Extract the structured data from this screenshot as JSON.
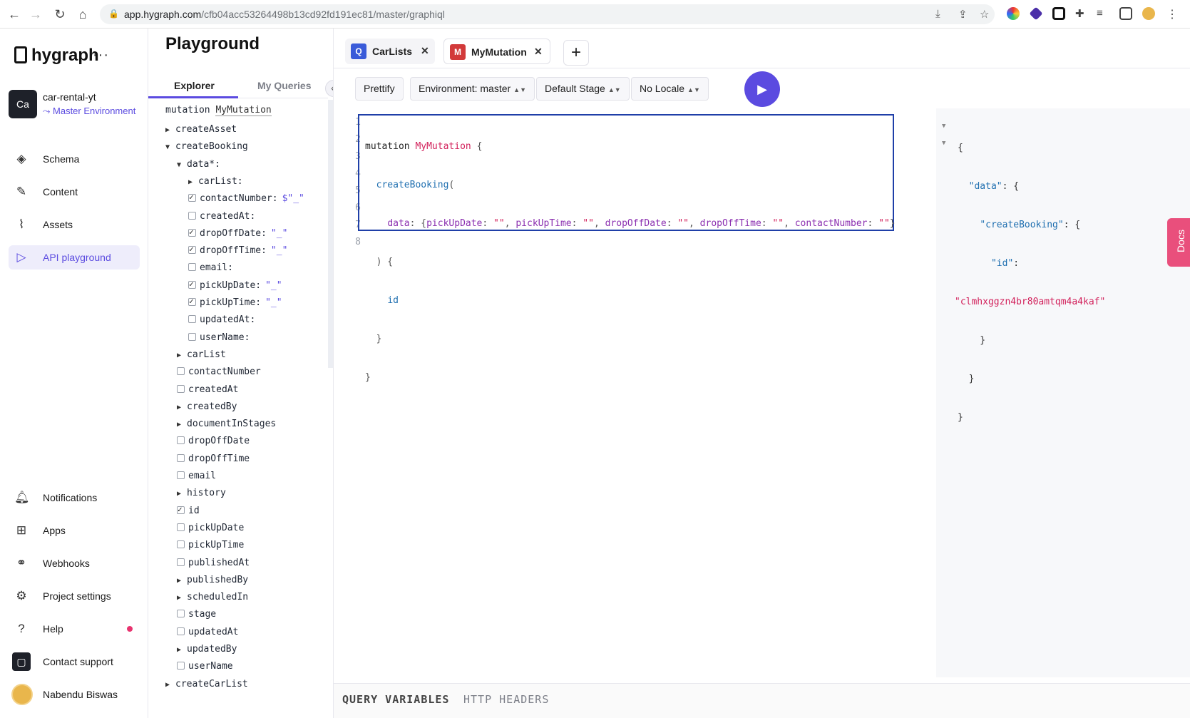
{
  "browser": {
    "url_host": "app.hygraph.com",
    "url_path": "/cfb04acc53264498b13cd92fd191ec81/master/graphiql"
  },
  "brand": {
    "name": "hygraph",
    "menu": "···"
  },
  "project": {
    "badge": "Ca",
    "name": "car-rental-yt",
    "environment": "Master Environment"
  },
  "nav": {
    "schema": "Schema",
    "content": "Content",
    "assets": "Assets",
    "api_playground": "API playground",
    "notifications": "Notifications",
    "apps": "Apps",
    "webhooks": "Webhooks",
    "project_settings": "Project settings",
    "help": "Help",
    "contact_support": "Contact support",
    "user": "Nabendu Biswas"
  },
  "explorer": {
    "title": "Playground",
    "tab_explorer": "Explorer",
    "tab_queries": "My Queries",
    "op_keyword": "mutation",
    "op_name": "MyMutation",
    "rows": [
      {
        "label": "createAsset",
        "kind": "arrow-right",
        "indent": 1
      },
      {
        "label": "createBooking",
        "kind": "arrow-down",
        "indent": 1
      },
      {
        "label": "data*:",
        "kind": "arrow-down",
        "indent": 2
      },
      {
        "label": "carList:",
        "kind": "arrow-right",
        "indent": 3
      },
      {
        "label": "contactNumber:",
        "kind": "checked",
        "indent": 3,
        "value": "$\"_\""
      },
      {
        "label": "createdAt:",
        "kind": "unchecked",
        "indent": 3
      },
      {
        "label": "dropOffDate:",
        "kind": "checked",
        "indent": 3,
        "value": "\"_\""
      },
      {
        "label": "dropOffTime:",
        "kind": "checked",
        "indent": 3,
        "value": "\"_\""
      },
      {
        "label": "email:",
        "kind": "unchecked",
        "indent": 3
      },
      {
        "label": "pickUpDate:",
        "kind": "checked",
        "indent": 3,
        "value": "\"_\""
      },
      {
        "label": "pickUpTime:",
        "kind": "checked",
        "indent": 3,
        "value": "\"_\""
      },
      {
        "label": "updatedAt:",
        "kind": "unchecked",
        "indent": 3
      },
      {
        "label": "userName:",
        "kind": "unchecked",
        "indent": 3
      },
      {
        "label": "carList",
        "kind": "arrow-right",
        "indent": 2
      },
      {
        "label": "contactNumber",
        "kind": "unchecked",
        "indent": 2
      },
      {
        "label": "createdAt",
        "kind": "unchecked",
        "indent": 2
      },
      {
        "label": "createdBy",
        "kind": "arrow-right",
        "indent": 2
      },
      {
        "label": "documentInStages",
        "kind": "arrow-right",
        "indent": 2
      },
      {
        "label": "dropOffDate",
        "kind": "unchecked",
        "indent": 2
      },
      {
        "label": "dropOffTime",
        "kind": "unchecked",
        "indent": 2
      },
      {
        "label": "email",
        "kind": "unchecked",
        "indent": 2
      },
      {
        "label": "history",
        "kind": "arrow-right",
        "indent": 2
      },
      {
        "label": "id",
        "kind": "checked",
        "indent": 2
      },
      {
        "label": "pickUpDate",
        "kind": "unchecked",
        "indent": 2
      },
      {
        "label": "pickUpTime",
        "kind": "unchecked",
        "indent": 2
      },
      {
        "label": "publishedAt",
        "kind": "unchecked",
        "indent": 2
      },
      {
        "label": "publishedBy",
        "kind": "arrow-right",
        "indent": 2
      },
      {
        "label": "scheduledIn",
        "kind": "arrow-right",
        "indent": 2
      },
      {
        "label": "stage",
        "kind": "unchecked",
        "indent": 2
      },
      {
        "label": "updatedAt",
        "kind": "unchecked",
        "indent": 2
      },
      {
        "label": "updatedBy",
        "kind": "arrow-right",
        "indent": 2
      },
      {
        "label": "userName",
        "kind": "unchecked",
        "indent": 2
      },
      {
        "label": "createCarList",
        "kind": "arrow-right",
        "indent": 1
      }
    ]
  },
  "query_tabs": [
    {
      "badge": "Q",
      "label": "CarLists",
      "color": "#3a5bd9"
    },
    {
      "badge": "M",
      "label": "MyMutation",
      "color": "#d23a3a"
    }
  ],
  "toolbar": {
    "prettify": "Prettify",
    "environment": "Environment: master",
    "stage": "Default Stage",
    "locale": "No Locale"
  },
  "editor": {
    "line_numbers": [
      "1",
      "2",
      "3",
      "4",
      "5",
      "6",
      "7",
      "8"
    ]
  },
  "result": {
    "id_value": "\"clmhxggzn4br80amtqm4a4kaf\""
  },
  "docs_label": "Docs",
  "bottom": {
    "variables": "QUERY VARIABLES",
    "headers": "HTTP HEADERS"
  },
  "colors": {
    "accent": "#5b4be0",
    "docs": "#e94f7c",
    "editor_border": "#1f3fa8"
  }
}
